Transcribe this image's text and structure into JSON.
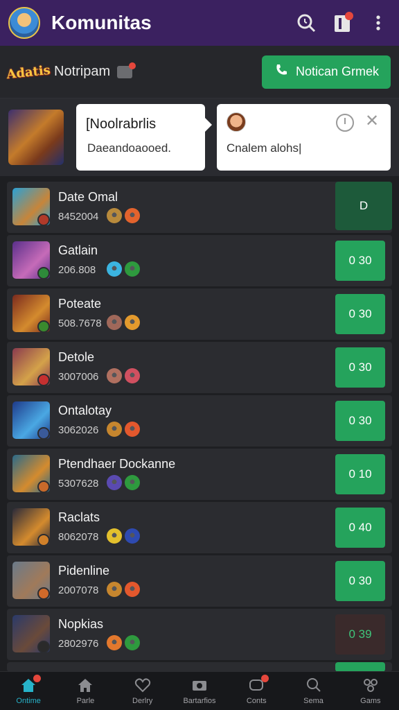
{
  "header": {
    "title": "Komunitas",
    "search_icon": "search-icon",
    "notes_icon": "notes-icon",
    "more_icon": "more-vertical-icon"
  },
  "subbar": {
    "logo_text": "Adatis",
    "label": "Notripam",
    "cta_label": "Notican Grmek",
    "cta_icon": "phone-icon"
  },
  "featured": {
    "card1": {
      "title": "[Noolrabrlis",
      "text": "Daeandoaooed."
    },
    "card2": {
      "text": "Cnalem alohs|"
    }
  },
  "colors": {
    "accent_green": "#25a35c",
    "header_purple": "#3b2160",
    "active_nav": "#27b3c9",
    "badge_red": "#e5473c"
  },
  "rows": [
    {
      "title": "Date Omal",
      "code": "8452004",
      "action": "D",
      "thumb": [
        "#2aa1d6",
        "#c7853a"
      ],
      "badge": "#b03a2a",
      "icons": [
        "#b88a3c",
        "#e3632d"
      ],
      "style": "dark"
    },
    {
      "title": "Gatlain",
      "code": "206.808",
      "action": "0 30",
      "thumb": [
        "#5a2f8a",
        "#c66bb8"
      ],
      "badge": "#2e8a3a",
      "icons": [
        "#3bb4e0",
        "#2e9a3e"
      ],
      "style": "green"
    },
    {
      "title": "Poteate",
      "code": "508.7678",
      "action": "0 30",
      "thumb": [
        "#7a2a1e",
        "#d48b2e"
      ],
      "badge": "#3a8a2e",
      "icons": [
        "#a0685a",
        "#e39a2d"
      ],
      "style": "green"
    },
    {
      "title": "Detole",
      "code": "3007006",
      "action": "0 30",
      "thumb": [
        "#8a3a4e",
        "#d4a24a"
      ],
      "badge": "#c53030",
      "icons": [
        "#b07060",
        "#d05060"
      ],
      "style": "green"
    },
    {
      "title": "Ontalotay",
      "code": "3062026",
      "action": "0 30",
      "thumb": [
        "#1e3a8a",
        "#4aa8e3"
      ],
      "badge": "#3a5a9a",
      "icons": [
        "#c6862e",
        "#e3582d"
      ],
      "style": "green"
    },
    {
      "title": "Ptendhaer Dockanne",
      "code": "5307628",
      "action": "0 10",
      "thumb": [
        "#2a6a8a",
        "#d48b2e"
      ],
      "badge": "#c86a2a",
      "icons": [
        "#5a4ab0",
        "#2e9a3e"
      ],
      "style": "green"
    },
    {
      "title": "Raclats",
      "code": "8062078",
      "action": "0 40",
      "thumb": [
        "#2a2a3a",
        "#d48b2e"
      ],
      "badge": "#d0802a",
      "icons": [
        "#e3c02d",
        "#2e4ab0"
      ],
      "style": "green"
    },
    {
      "title": "Pidenline",
      "code": "2007078",
      "action": "0 30",
      "thumb": [
        "#6a7a8a",
        "#a07a5a"
      ],
      "badge": "#d06a2a",
      "icons": [
        "#c6862e",
        "#e3582d"
      ],
      "style": "green"
    },
    {
      "title": "Nopkias",
      "code": "2802976",
      "action": "0 39",
      "thumb": [
        "#2a3a6a",
        "#6a4a3a"
      ],
      "badge": "#2a2a2a",
      "icons": [
        "#e3782d",
        "#2e9a3e"
      ],
      "style": "muted"
    }
  ],
  "bottom_nav": [
    {
      "label": "Ontime",
      "icon": "home-icon",
      "active": true,
      "badge": true
    },
    {
      "label": "Parle",
      "icon": "house-icon",
      "active": false,
      "badge": false
    },
    {
      "label": "Derlry",
      "icon": "heart-icon",
      "active": false,
      "badge": false
    },
    {
      "label": "Bartarfios",
      "icon": "camera-icon",
      "active": false,
      "badge": false
    },
    {
      "label": "Conts",
      "icon": "chat-icon",
      "active": false,
      "badge": true
    },
    {
      "label": "Sema",
      "icon": "search-icon",
      "active": false,
      "badge": false
    },
    {
      "label": "Gams",
      "icon": "games-icon",
      "active": false,
      "badge": false
    }
  ]
}
